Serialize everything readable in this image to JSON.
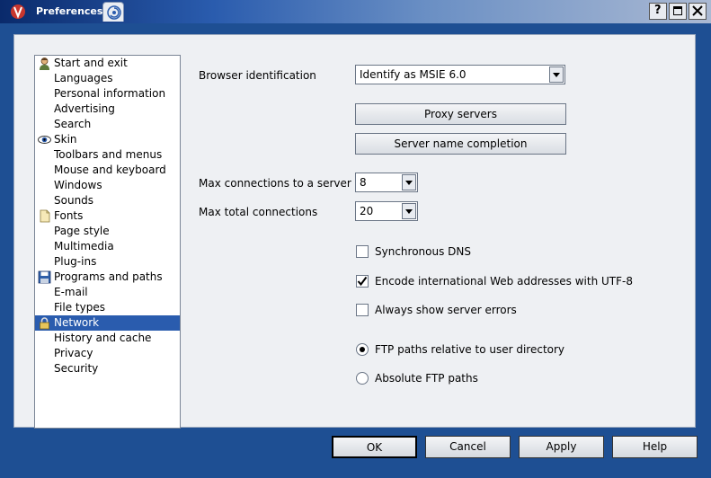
{
  "window": {
    "title": "Preferences",
    "accent": "#2a5cae"
  },
  "sidebar": {
    "items": [
      {
        "label": "Start and exit",
        "icon": "person-icon"
      },
      {
        "label": "Languages"
      },
      {
        "label": "Personal information"
      },
      {
        "label": "Advertising"
      },
      {
        "label": "Search"
      },
      {
        "label": "Skin",
        "icon": "eye-icon"
      },
      {
        "label": "Toolbars and menus"
      },
      {
        "label": "Mouse and keyboard"
      },
      {
        "label": "Windows"
      },
      {
        "label": "Sounds"
      },
      {
        "label": "Fonts",
        "icon": "page-icon"
      },
      {
        "label": "Page style"
      },
      {
        "label": "Multimedia"
      },
      {
        "label": "Plug-ins"
      },
      {
        "label": "Programs and paths",
        "icon": "floppy-icon"
      },
      {
        "label": "E-mail"
      },
      {
        "label": "File types"
      },
      {
        "label": "Network",
        "icon": "lock-icon",
        "selected": true
      },
      {
        "label": "History and cache"
      },
      {
        "label": "Privacy"
      },
      {
        "label": "Security"
      }
    ]
  },
  "network": {
    "browser_id_label": "Browser identification",
    "browser_id_value": "Identify as MSIE 6.0",
    "proxy_button": "Proxy servers",
    "server_completion_button": "Server name completion",
    "max_conn_server_label": "Max connections to a server",
    "max_conn_server_value": "8",
    "max_total_label": "Max total connections",
    "max_total_value": "20",
    "sync_dns_label": "Synchronous DNS",
    "sync_dns_checked": false,
    "utf8_label": "Encode international Web addresses with UTF-8",
    "utf8_checked": true,
    "server_errors_label": "Always show server errors",
    "server_errors_checked": false,
    "ftp_relative_label": "FTP paths relative to user directory",
    "ftp_absolute_label": "Absolute FTP paths",
    "ftp_mode": "relative"
  },
  "buttons": {
    "ok": "OK",
    "cancel": "Cancel",
    "apply": "Apply",
    "help": "Help"
  }
}
